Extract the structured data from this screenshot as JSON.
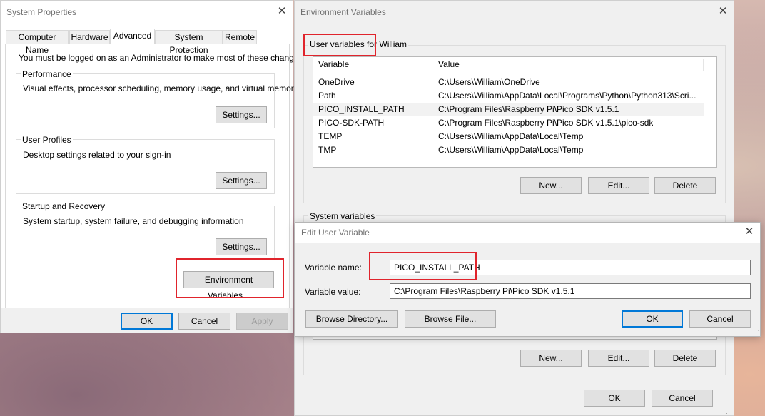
{
  "system_properties": {
    "title": "System Properties",
    "tabs": [
      "Computer Name",
      "Hardware",
      "Advanced",
      "System Protection",
      "Remote"
    ],
    "admin_note": "You must be logged on as an Administrator to make most of these changes.",
    "performance": {
      "label": "Performance",
      "desc": "Visual effects, processor scheduling, memory usage, and virtual memory",
      "settings": "Settings..."
    },
    "user_profiles": {
      "label": "User Profiles",
      "desc": "Desktop settings related to your sign-in",
      "settings": "Settings..."
    },
    "startup": {
      "label": "Startup and Recovery",
      "desc": "System startup, system failure, and debugging information",
      "settings": "Settings..."
    },
    "env_button": "Environment Variables...",
    "ok": "OK",
    "cancel": "Cancel",
    "apply": "Apply"
  },
  "env_vars": {
    "title": "Environment Variables",
    "user_section_label": "User variables for William",
    "columns": [
      "Variable",
      "Value"
    ],
    "user_vars": [
      {
        "name": "OneDrive",
        "value": "C:\\Users\\William\\OneDrive"
      },
      {
        "name": "Path",
        "value": "C:\\Users\\William\\AppData\\Local\\Programs\\Python\\Python313\\Scri..."
      },
      {
        "name": "PICO_INSTALL_PATH",
        "value": "C:\\Program Files\\Raspberry Pi\\Pico SDK v1.5.1"
      },
      {
        "name": "PICO-SDK-PATH",
        "value": "C:\\Program Files\\Raspberry Pi\\Pico SDK v1.5.1\\pico-sdk"
      },
      {
        "name": "TEMP",
        "value": "C:\\Users\\William\\AppData\\Local\\Temp"
      },
      {
        "name": "TMP",
        "value": "C:\\Users\\William\\AppData\\Local\\Temp"
      }
    ],
    "user_new": "New...",
    "user_edit": "Edit...",
    "user_delete": "Delete",
    "system_section_label": "System variables",
    "sys_new": "New...",
    "sys_edit": "Edit...",
    "sys_delete": "Delete",
    "ok": "OK",
    "cancel": "Cancel"
  },
  "edit_dialog": {
    "title": "Edit User Variable",
    "name_label": "Variable name:",
    "name_value": "PICO_INSTALL_PATH",
    "value_label": "Variable value:",
    "value_value": "C:\\Program Files\\Raspberry Pi\\Pico SDK v1.5.1",
    "browse_dir": "Browse Directory...",
    "browse_file": "Browse File...",
    "ok": "OK",
    "cancel": "Cancel"
  },
  "colors": {
    "highlight_red": "#e0242c",
    "default_button_blue": "#0078d7"
  }
}
